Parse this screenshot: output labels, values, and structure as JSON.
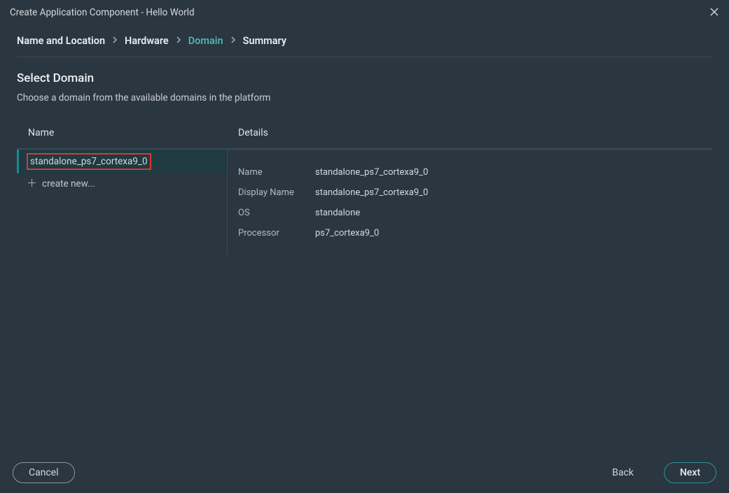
{
  "titlebar": {
    "title": "Create Application Component - Hello World"
  },
  "breadcrumb": {
    "items": [
      {
        "label": "Name and Location",
        "active": false
      },
      {
        "label": "Hardware",
        "active": false
      },
      {
        "label": "Domain",
        "active": true
      },
      {
        "label": "Summary",
        "active": false
      }
    ]
  },
  "page": {
    "title": "Select Domain",
    "description": "Choose a domain from the available domains in the platform"
  },
  "columns": {
    "name_header": "Name",
    "details_header": "Details"
  },
  "domains": {
    "items": [
      {
        "name": "standalone_ps7_cortexa9_0",
        "selected": true,
        "highlighted": true
      }
    ],
    "create_new_label": "create new..."
  },
  "details": {
    "fields": [
      {
        "key": "Name",
        "value": "standalone_ps7_cortexa9_0"
      },
      {
        "key": "Display Name",
        "value": "standalone_ps7_cortexa9_0"
      },
      {
        "key": "OS",
        "value": "standalone"
      },
      {
        "key": "Processor",
        "value": "ps7_cortexa9_0"
      }
    ]
  },
  "footer": {
    "cancel": "Cancel",
    "back": "Back",
    "next": "Next"
  }
}
